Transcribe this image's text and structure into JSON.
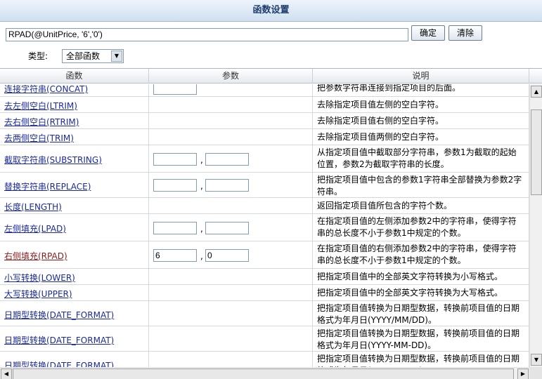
{
  "dialog": {
    "title": "函数设置"
  },
  "expression": {
    "value": "RPAD(@UnitPrice, '6','0')"
  },
  "buttons": {
    "ok": "确定",
    "clear": "清除"
  },
  "filter": {
    "label": "类型:",
    "selected": "全部函数"
  },
  "table": {
    "headers": {
      "func": "函数",
      "param": "参数",
      "desc": "说明"
    },
    "rows": [
      {
        "name": "连接字符串(CONCAT)",
        "params": [
          ""
        ],
        "desc": "把参数字符串连接到指定项目的后面。",
        "h": 25
      },
      {
        "name": "去左侧空白(LTRIM)",
        "params": [],
        "desc": "去除指定项目值左侧的空白字符。",
        "h": 23
      },
      {
        "name": "去右侧空白(RTRIM)",
        "params": [],
        "desc": "去除指定项目值右侧的空白字符。",
        "h": 23
      },
      {
        "name": "去两侧空白(TRIM)",
        "params": [],
        "desc": "去除指定项目值两侧的空白字符。",
        "h": 23
      },
      {
        "name": "截取字符串(SUBSTRING)",
        "params": [
          "",
          ""
        ],
        "desc": "从指定项目值中截取部分字符串，参数1为截取的起始位置，参数2为截取字符串的长度。",
        "h": 39
      },
      {
        "name": "替换字符串(REPLACE)",
        "params": [
          "",
          ""
        ],
        "desc": "把指定项目值中包含的参数1字符串全部替换为参数2字符串。",
        "h": 36
      },
      {
        "name": "长度(LENGTH)",
        "params": [],
        "desc": "返回指定项目值所包含的字符个数。",
        "h": 23
      },
      {
        "name": "左侧填充(LPAD)",
        "params": [
          "",
          ""
        ],
        "desc": "在指定项目值的左侧添加参数2中的字符串，使得字符串的总长度不小于参数1中规定的个数。",
        "h": 39
      },
      {
        "name": "右侧填充(RPAD)",
        "params": [
          "6",
          "0"
        ],
        "desc": "在指定项目值的右侧添加参数2中的字符串，使得字符串的总长度不小于参数1中规定的个数。",
        "h": 39,
        "active": true
      },
      {
        "name": "小写转换(LOWER)",
        "params": [],
        "desc": "把指定项目值中的全部英文字符转换为小写格式。",
        "h": 23
      },
      {
        "name": "大写转换(UPPER)",
        "params": [],
        "desc": "把指定项目值中的全部英文字符转换为大写格式。",
        "h": 23
      },
      {
        "name": "日期型转换(DATE_FORMAT)",
        "params": [],
        "desc": "把指定项目值转换为日期型数据，转换前项目值的日期格式为年月日(YYYY/MM/DD)。",
        "h": 36
      },
      {
        "name": "日期型转换(DATE_FORMAT)",
        "params": [],
        "desc": "把指定项目值转换为日期型数据，转换前项目值的日期格式为年月日(YYYY-MM-DD)。",
        "h": 36
      },
      {
        "name": "日期型转换(DATE_FORMAT)",
        "params": [],
        "desc": "把指定项目值转换为日期型数据，转换前项目值的日期格式为年月日(YYYYMMDD)。",
        "h": 36
      }
    ]
  },
  "icons": {
    "select_arrow": "triangle-down-icon",
    "scroll_up": "triangle-up-icon",
    "scroll_down": "triangle-down-icon",
    "scroll_left": "triangle-left-icon",
    "scroll_right": "triangle-right-icon"
  },
  "colors": {
    "link": "#1a2a9c",
    "active_link": "#8b1a1a",
    "title": "#1f3f6e"
  }
}
